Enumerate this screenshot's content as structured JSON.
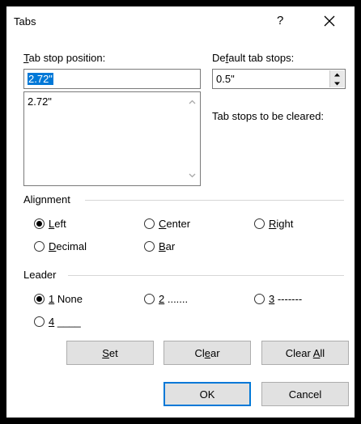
{
  "dialog": {
    "title": "Tabs",
    "help": "?",
    "close_icon": "close-icon"
  },
  "tab_stop_position": {
    "label_mnemonic": "T",
    "label_rest": "ab stop position:",
    "value": "2.72\"",
    "list_items": [
      "2.72\""
    ]
  },
  "default_tab_stops": {
    "label_pre": "De",
    "label_mnemonic": "f",
    "label_rest": "ault tab stops:",
    "value": "0.5\""
  },
  "tab_stops_cleared_label": "Tab stops to be cleared:",
  "alignment": {
    "label": "Alignment",
    "options": [
      {
        "mnemonic": "L",
        "rest": "eft",
        "selected": true
      },
      {
        "mnemonic": "C",
        "rest": "enter",
        "selected": false
      },
      {
        "mnemonic": "R",
        "rest": "ight",
        "selected": false
      },
      {
        "mnemonic": "D",
        "rest": "ecimal",
        "selected": false
      },
      {
        "mnemonic": "B",
        "rest": "ar",
        "selected": false
      }
    ]
  },
  "leader": {
    "label": "Leader",
    "options": [
      {
        "mnemonic": "1",
        "rest": " None",
        "selected": true
      },
      {
        "mnemonic": "2",
        "rest": " .......",
        "selected": false
      },
      {
        "mnemonic": "3",
        "rest": " -------",
        "selected": false
      },
      {
        "mnemonic": "4",
        "rest": " ____",
        "selected": false
      }
    ]
  },
  "buttons": {
    "set": {
      "mnemonic": "S",
      "rest": "et"
    },
    "clear": {
      "pre": "Cl",
      "mnemonic": "e",
      "rest": "ar"
    },
    "clear_all": {
      "pre": "Clear ",
      "mnemonic": "A",
      "rest": "ll"
    },
    "ok": "OK",
    "cancel": "Cancel"
  }
}
